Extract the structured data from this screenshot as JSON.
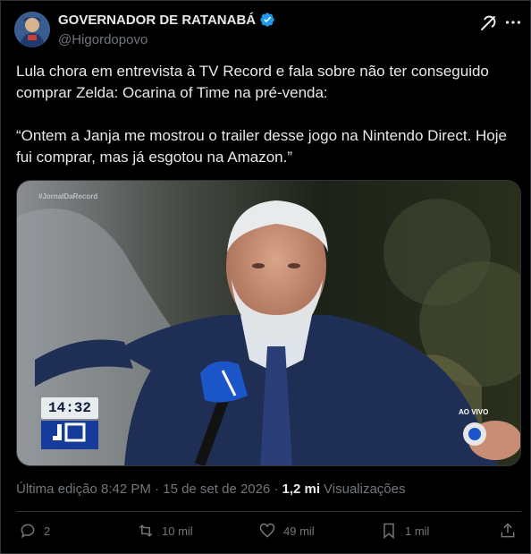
{
  "author": {
    "display_name": "GOVERNADOR DE RATANABÁ",
    "handle": "@Higordopovo"
  },
  "post": {
    "text": "Lula chora em entrevista à TV Record e fala sobre não ter conseguido comprar Zelda: Ocarina of Time na pré-venda:\n\n“Ontem a Janja me mostrou o trailer desse jogo na Nintendo Direct. Hoje fui comprar, mas já esgotou na Amazon.”"
  },
  "media": {
    "watermark": "#JornalDaRecord",
    "clock": "14:32",
    "live_label": "AO VIVO"
  },
  "meta": {
    "edited": "Última edição 8:42 PM · 15 de set de 2026 ·",
    "views_count": "1,2 mi",
    "views_label": "Visualizações"
  },
  "actions": {
    "replies": "2",
    "reposts": "10 mil",
    "likes": "49 mil",
    "bookmarks": "1 mil"
  },
  "colors": {
    "background": "#000000",
    "text": "#e7e9ea",
    "muted": "#71767b",
    "verified": "#1d9bf0",
    "border": "#2f3336"
  },
  "icons": [
    "verified-badge-icon",
    "grok-icon",
    "more-icon",
    "reply-icon",
    "repost-icon",
    "like-icon",
    "bookmark-icon",
    "share-icon"
  ]
}
